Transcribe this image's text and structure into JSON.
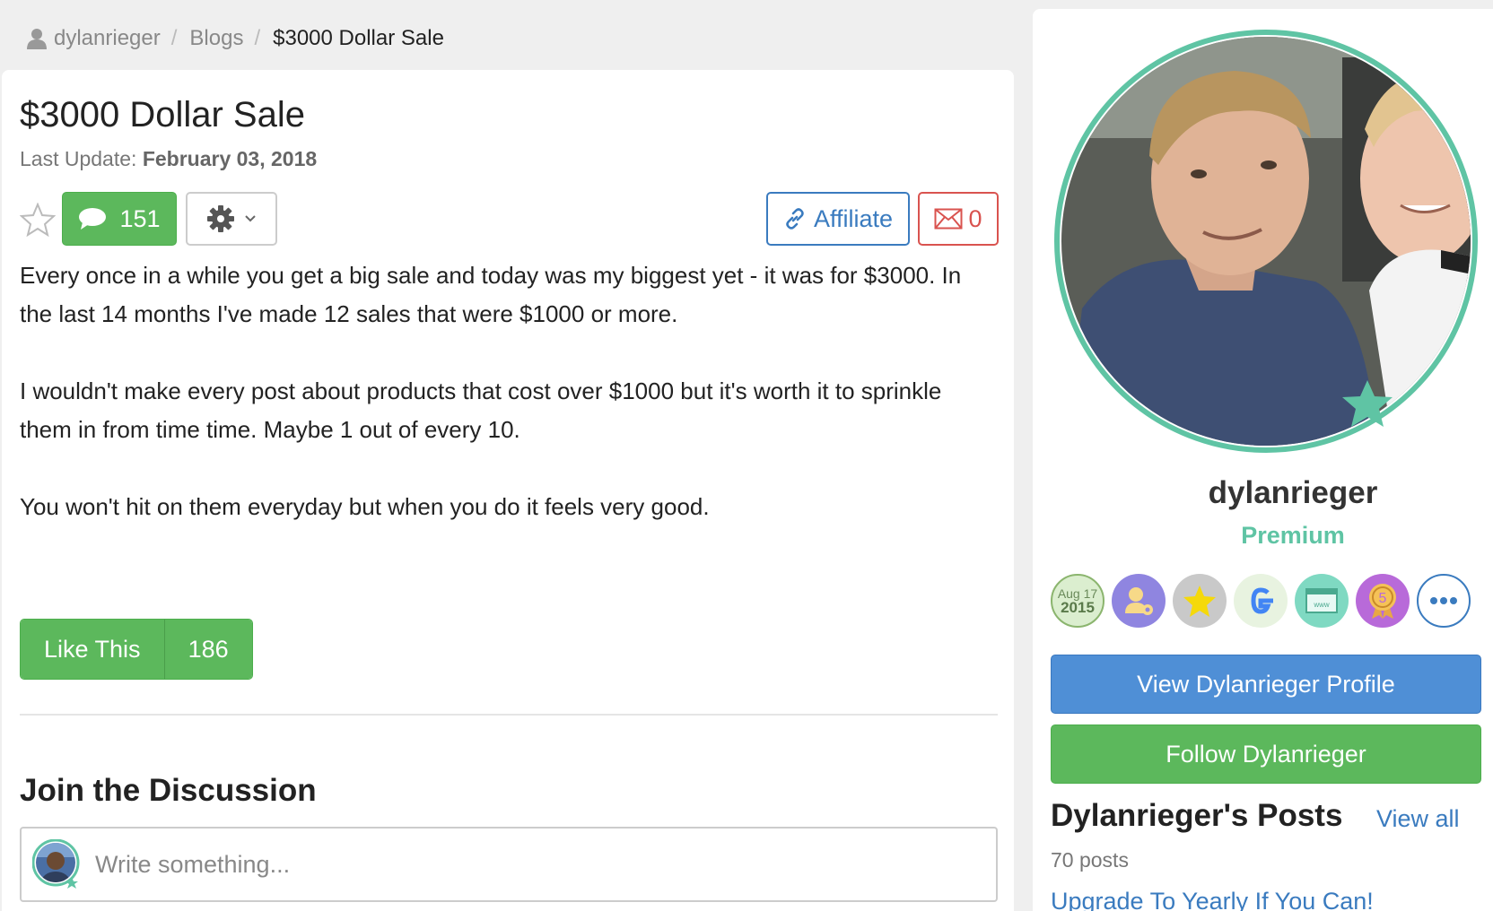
{
  "breadcrumb": {
    "user": "dylanrieger",
    "section": "Blogs",
    "current": "$3000 Dollar Sale",
    "separator": "/"
  },
  "post": {
    "title": "$3000 Dollar Sale",
    "last_update_label": "Last Update:",
    "last_update_date": "February 03, 2018",
    "comments_count": "151",
    "affiliate_label": "Affiliate",
    "messages_count": "0",
    "paragraphs": [
      "Every once in a while you get a big sale and today was my biggest yet - it was for $3000. In the last 14 months I've made 12 sales that were $1000 or more.",
      "I wouldn't make every post about products that cost over $1000 but it's worth it to sprinkle them in from time time. Maybe 1 out of every 10.",
      "You won't hit on them everyday but when you do it feels very good."
    ],
    "like_label": "Like This",
    "like_count": "186"
  },
  "discussion": {
    "title": "Join the Discussion",
    "placeholder": "Write something..."
  },
  "sidebar": {
    "username": "dylanrieger",
    "membership": "Premium",
    "join_badge": {
      "month_day": "Aug 17",
      "year": "2015"
    },
    "view_profile_label": "View Dylanrieger Profile",
    "follow_label": "Follow Dylanrieger",
    "posts_title": "Dylanrieger's Posts",
    "view_all_label": "View all",
    "posts_count": "70 posts",
    "first_post": "Upgrade To Yearly If You Can!"
  },
  "colors": {
    "green": "#5cb85c",
    "blue": "#4f8fd6",
    "link_blue": "#3a7bbf",
    "red": "#d9534f",
    "premium_teal": "#5fc4a4"
  }
}
